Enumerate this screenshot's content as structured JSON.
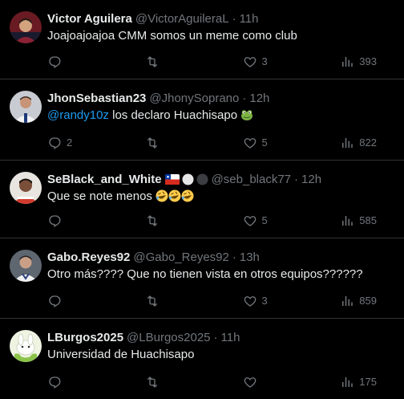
{
  "tweets": [
    {
      "name": "Victor Aguilera",
      "handle": "@VictorAguileraL",
      "time": "11h",
      "text": "Joajoajoajoa CMM somos un meme como club",
      "mention": "",
      "replies": "",
      "retweets": "",
      "likes": "3",
      "views": "393"
    },
    {
      "name": "JhonSebastian23",
      "handle": "@JhonySoprano",
      "time": "12h",
      "mention": "@randy10z",
      "text": " los declaro Huachisapo",
      "replies": "2",
      "retweets": "",
      "likes": "5",
      "views": "822"
    },
    {
      "name": "SeBlack_and_White",
      "handle": "@seb_black77",
      "time": "12h",
      "mention": "",
      "text": "Que se note menos ",
      "replies": "",
      "retweets": "",
      "likes": "5",
      "views": "585"
    },
    {
      "name": "Gabo.Reyes92",
      "handle": "@Gabo_Reyes92",
      "time": "13h",
      "mention": "",
      "text": "Otro más???? Que no tienen vista en otros equipos??????",
      "replies": "",
      "retweets": "",
      "likes": "3",
      "views": "859"
    },
    {
      "name": "LBurgos2025",
      "handle": "@LBurgos2025",
      "time": "11h",
      "mention": "",
      "text": "Universidad de Huachisapo",
      "replies": "",
      "retweets": "",
      "likes": "",
      "views": "175"
    }
  ],
  "separator": "·",
  "icons": {
    "reply": "reply-icon",
    "retweet": "retweet-icon",
    "like": "heart-icon",
    "views": "views-icon"
  },
  "colors": {
    "background": "#000000",
    "text": "#e7e9ea",
    "muted": "#71767b",
    "mention": "#1d9bf0",
    "border": "#2f3336"
  }
}
